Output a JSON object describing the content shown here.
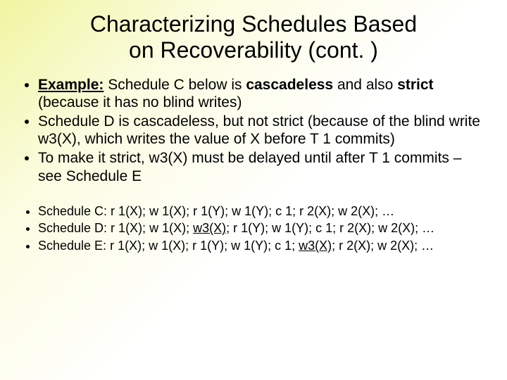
{
  "title_line1": "Characterizing Schedules Based",
  "title_line2": "on Recoverability (cont. )",
  "bullets": {
    "b1_pre": "Example:",
    "b1_mid1": " Schedule C below is ",
    "b1_bold1": "cascadeless",
    "b1_mid2": " and also ",
    "b1_bold2": "strict",
    "b1_post": " (because it has no blind writes)",
    "b2": "Schedule D is cascadeless, but not strict (because of the blind write w3(X), which writes the value of X before T 1 commits)",
    "b3": "To make it strict, w3(X) must be delayed until after T 1 commits – see Schedule E"
  },
  "schedules": {
    "c": "Schedule C: r 1(X); w 1(X); r 1(Y); w 1(Y); c 1; r 2(X); w 2(X); …",
    "d_pre": "Schedule D: r 1(X); w 1(X); ",
    "d_u": "w3(X);",
    "d_post": " r 1(Y); w 1(Y); c 1; r 2(X); w 2(X); …",
    "e_pre": "Schedule E: r 1(X); w 1(X); r 1(Y); w 1(Y); c 1; ",
    "e_u": "w3(X);",
    "e_post": " r 2(X); w 2(X); …"
  }
}
